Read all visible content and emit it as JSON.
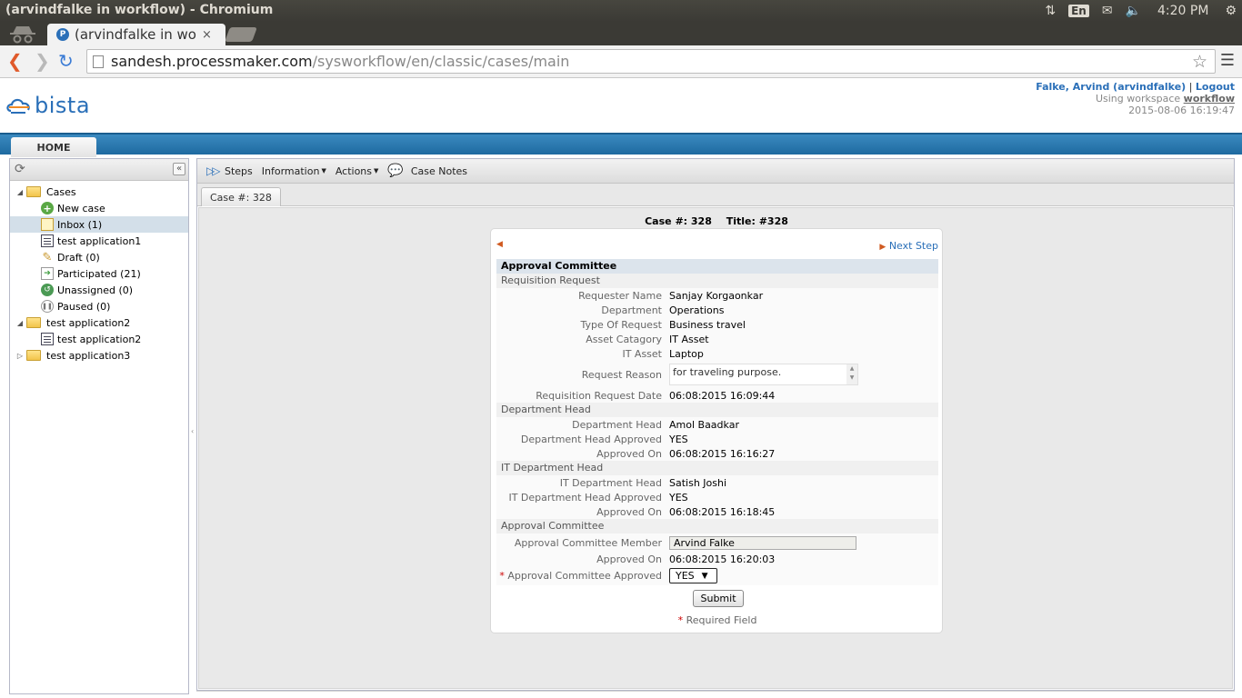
{
  "window": {
    "title": "(arvindfalke in workflow) - Chromium"
  },
  "tray": {
    "lang": "En",
    "clock": "4:20 PM"
  },
  "browser": {
    "tab_title": "(arvindfalke in workflow) - ProcessMaker",
    "tab_close": "×",
    "url_host": "sandesh.processmaker.com",
    "url_path": "/sysworkflow/en/classic/cases/main"
  },
  "header": {
    "logo_text": "bista",
    "user_name": "Falke, Arvind (arvindfalke)",
    "separator": "|",
    "logout": "Logout",
    "workspace_prefix": "Using workspace",
    "workspace": "workflow",
    "datetime": "2015-08-06 16:19:47"
  },
  "nav": {
    "home": "HOME"
  },
  "tree": {
    "root": "Cases",
    "items": [
      {
        "label": "New case",
        "icon": "new-case-icon"
      },
      {
        "label": "Inbox (1)",
        "icon": "inbox-icon"
      },
      {
        "label": "test application1",
        "icon": "application-icon"
      },
      {
        "label": "Draft (0)",
        "icon": "draft-icon"
      },
      {
        "label": "Participated (21)",
        "icon": "participated-icon"
      },
      {
        "label": "Unassigned (0)",
        "icon": "unassigned-icon"
      },
      {
        "label": "Paused (0)",
        "icon": "paused-icon"
      }
    ],
    "folder2": "test application2",
    "folder2_items": [
      {
        "label": "test application2",
        "icon": "application-icon"
      }
    ],
    "folder3": "test application3"
  },
  "toolbar": {
    "steps": "Steps",
    "information": "Information",
    "actions": "Actions",
    "case_notes": "Case Notes"
  },
  "case_tab": "Case #: 328",
  "case_header": {
    "case_no": "Case #: 328",
    "title": "Title: #328"
  },
  "form": {
    "next_step": "Next Step",
    "title": "Approval Committee",
    "sections": {
      "requisition": "Requisition Request",
      "dept_head": "Department Head",
      "it_head": "IT Department Head",
      "committee": "Approval Committee"
    },
    "requisition_fields": [
      {
        "label": "Requester Name",
        "value": "Sanjay Korgaonkar"
      },
      {
        "label": "Department",
        "value": "Operations"
      },
      {
        "label": "Type Of Request",
        "value": "Business travel"
      },
      {
        "label": "Asset Catagory",
        "value": "IT Asset"
      },
      {
        "label": "IT Asset",
        "value": "Laptop"
      }
    ],
    "request_reason_label": "Request Reason",
    "request_reason": "for traveling purpose.",
    "requisition_date_label": "Requisition Request Date",
    "requisition_date": "06:08:2015 16:09:44",
    "dept_fields": [
      {
        "label": "Department Head",
        "value": "Amol Baadkar"
      },
      {
        "label": "Department Head Approved",
        "value": "YES"
      },
      {
        "label": "Approved On",
        "value": "06:08:2015 16:16:27"
      }
    ],
    "it_fields": [
      {
        "label": "IT Department Head",
        "value": "Satish Joshi"
      },
      {
        "label": "IT Department Head Approved",
        "value": "YES"
      },
      {
        "label": "Approved On",
        "value": "06:08:2015 16:18:45"
      }
    ],
    "member_label": "Approval Committee Member",
    "member_value": "Arvind Falke",
    "committee_approved_on_label": "Approved On",
    "committee_approved_on": "06:08:2015 16:20:03",
    "approved_label": "Approval Committee Approved",
    "approved_value": "YES",
    "required_mark": "*",
    "submit": "Submit",
    "required_note": "Required Field"
  }
}
